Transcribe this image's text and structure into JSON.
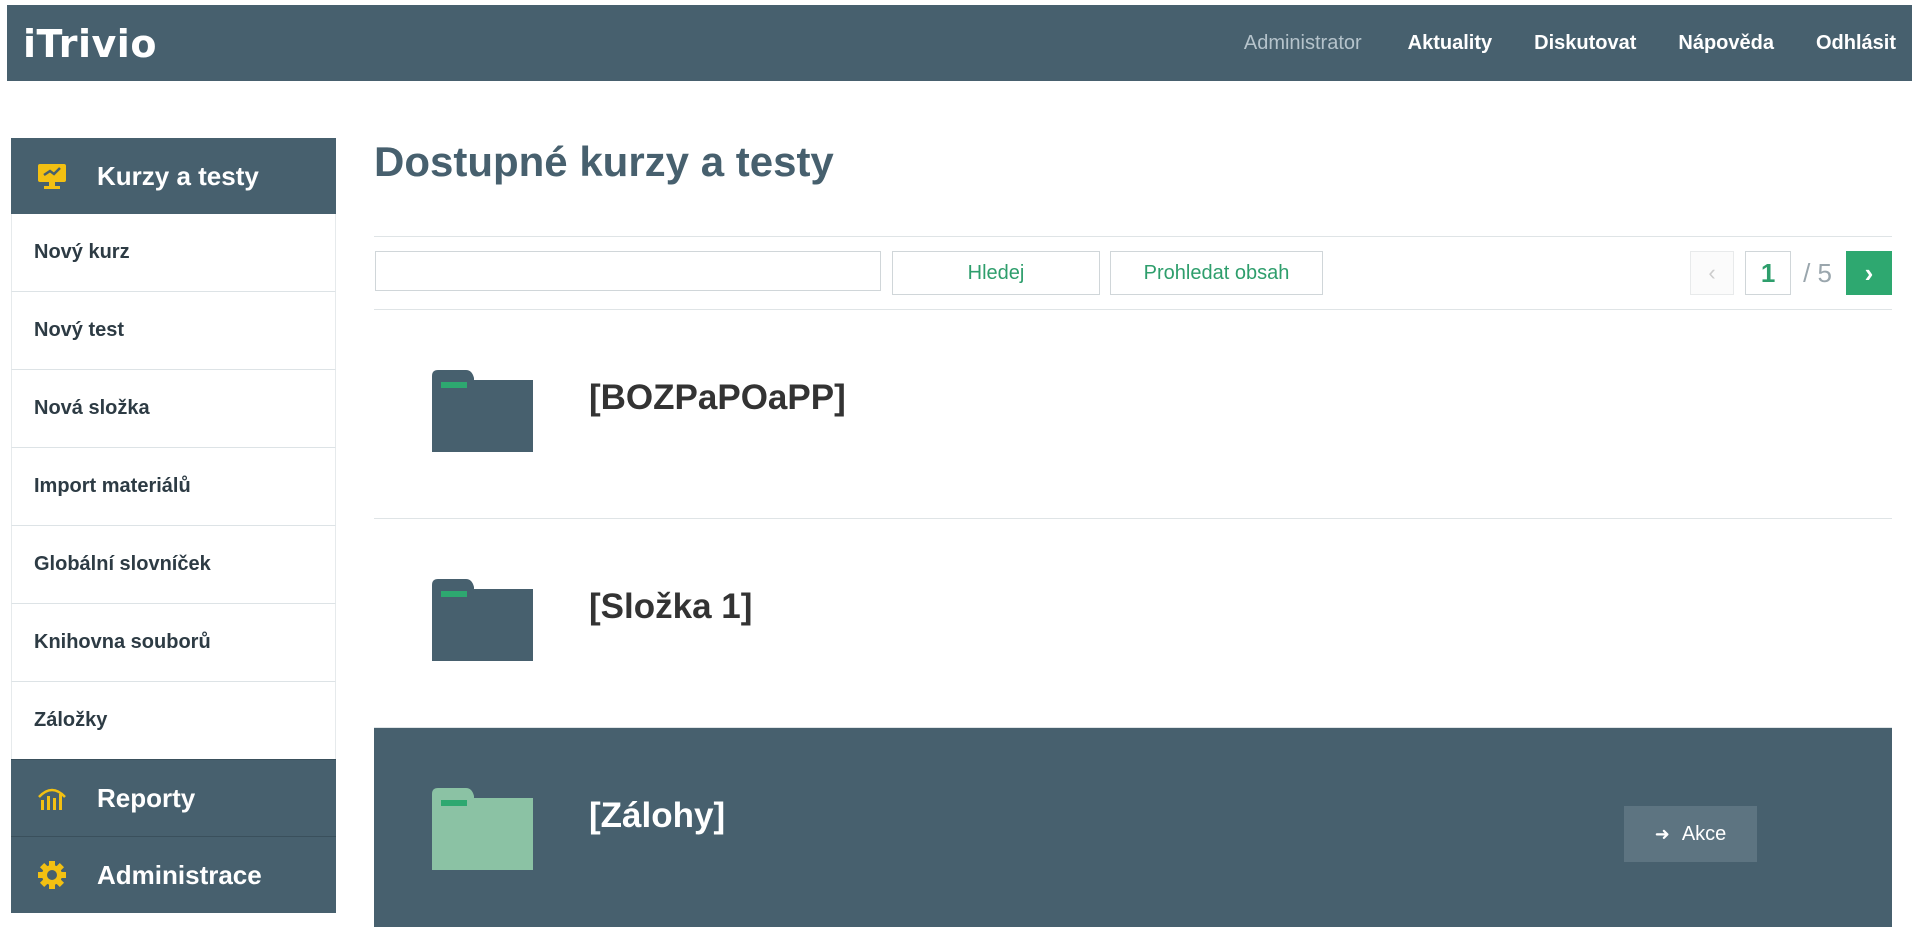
{
  "app": {
    "logo": "iTrivio"
  },
  "topnav": {
    "user": "Administrator",
    "items": [
      "Aktuality",
      "Diskutovat",
      "Nápověda",
      "Odhlásit"
    ]
  },
  "sidebar": {
    "section_main": "Kurzy a testy",
    "items": [
      "Nový kurz",
      "Nový test",
      "Nová složka",
      "Import materiálů",
      "Globální slovníček",
      "Knihovna souborů",
      "Záložky"
    ],
    "section_reports": "Reporty",
    "section_admin": "Administrace"
  },
  "main": {
    "title": "Dostupné kurzy a testy",
    "search": {
      "value": "",
      "find_label": "Hledej",
      "content_label": "Prohledat obsah"
    },
    "pager": {
      "prev": "‹",
      "current": "1",
      "total": "/ 5",
      "next": "›"
    },
    "folders": [
      {
        "name": "[BOZPaPOaPP]",
        "selected": false
      },
      {
        "name": "[Složka 1]",
        "selected": false
      },
      {
        "name": "[Zálohy]",
        "selected": true,
        "action": "Akce"
      }
    ]
  },
  "colors": {
    "primary": "#47606e",
    "accent_green": "#2ea870",
    "folder_dark": "#47606e",
    "folder_light": "#8bc2a4",
    "sidebar_icon": "#f3c012"
  },
  "icons": {
    "kurzy": "monitor-icon",
    "reporty": "chart-icon",
    "administrace": "gear-icon",
    "folder": "folder-icon",
    "akce": "arrow-right-icon"
  }
}
